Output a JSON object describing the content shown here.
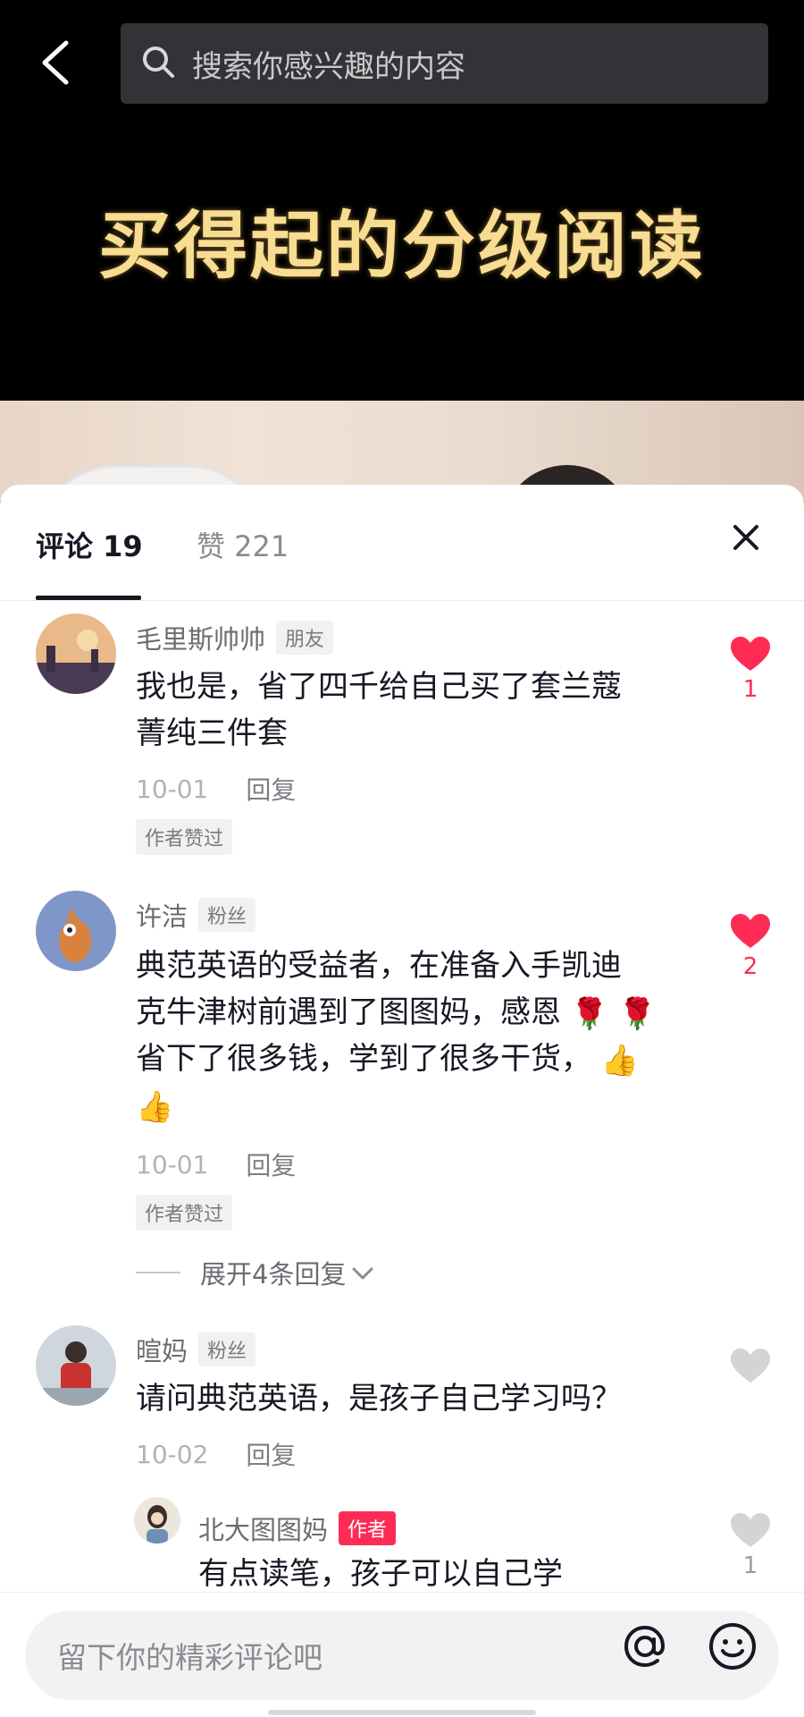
{
  "header": {
    "search_placeholder": "搜索你感兴趣的内容",
    "icons": [
      "back-arrow-icon",
      "search-icon"
    ]
  },
  "video": {
    "title_overlay": "买得起的分级阅读"
  },
  "comment_panel": {
    "tabs": [
      {
        "label": "评论 19",
        "active": true
      },
      {
        "label": "赞 221",
        "active": false
      }
    ],
    "close_icon": "close-icon",
    "comments": [
      {
        "username": "毛里斯帅帅",
        "tag": "朋友",
        "text_line1": "我也是，省了四千给自己买了套兰蔻",
        "text_line2": "菁纯三件套",
        "date": "10-01",
        "reply_label": "回复",
        "author_liked": "作者赞过",
        "likes": "1",
        "liked": true
      },
      {
        "username": "许洁",
        "tag": "粉丝",
        "text_line1": "典范英语的受益者，在准备入手凯迪",
        "text_line2": "克牛津树前遇到了图图妈，感恩",
        "text_line3": "省下了很多钱，学到了很多干货，",
        "emoji_rose": "🌹",
        "emoji_thumb": "👍",
        "date": "10-01",
        "reply_label": "回复",
        "author_liked": "作者赞过",
        "expand_label": "展开4条回复",
        "likes": "2",
        "liked": true
      },
      {
        "username": "暄妈",
        "tag": "粉丝",
        "text_line1": "请问典范英语，是孩子自己学习吗？",
        "date": "10-02",
        "reply_label": "回复",
        "likes": "",
        "liked": false
      }
    ],
    "reply": {
      "username": "北大图图妈",
      "tag": "作者",
      "text_line1": "有点读笔，孩子可以自己学",
      "likes": "1",
      "liked": false
    }
  },
  "input_bar": {
    "placeholder": "留下你的精彩评论吧",
    "icons": [
      "at-icon",
      "emoji-icon"
    ]
  },
  "colors": {
    "accent": "#fe2c55",
    "title_gold": "#f7dc92",
    "search_bg": "#333236"
  }
}
